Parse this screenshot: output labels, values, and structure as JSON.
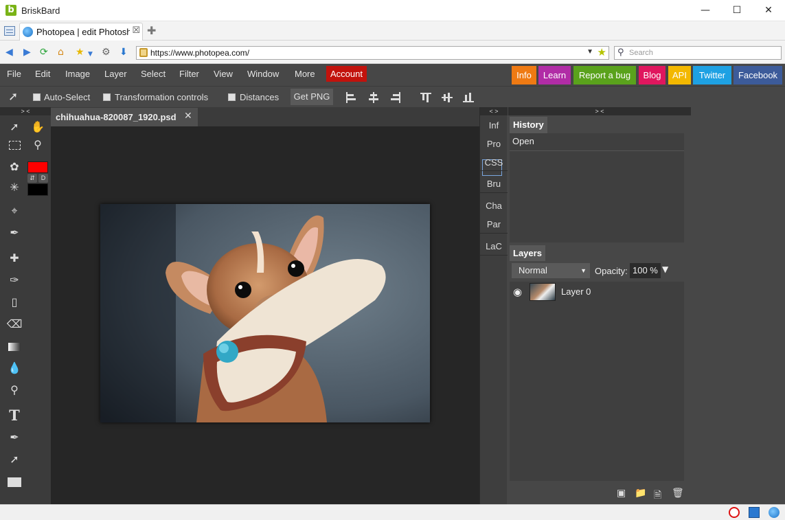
{
  "browser": {
    "title": "BriskBard",
    "logo_letter": "b",
    "tab_label": "Photopea | edit Photoshop",
    "url": "https://www.photopea.com/",
    "search_placeholder": "Search"
  },
  "menu": {
    "items": [
      "File",
      "Edit",
      "Image",
      "Layer",
      "Select",
      "Filter",
      "View",
      "Window",
      "More"
    ],
    "account": "Account",
    "links": [
      {
        "label": "Info",
        "color": "#ef7a13"
      },
      {
        "label": "Learn",
        "color": "#b12ca6"
      },
      {
        "label": "Report a bug",
        "color": "#5aa21c"
      },
      {
        "label": "Blog",
        "color": "#e0165e"
      },
      {
        "label": "API",
        "color": "#f3b800"
      },
      {
        "label": "Twitter",
        "color": "#1ea1e3"
      },
      {
        "label": "Facebook",
        "color": "#3c5b9a"
      }
    ]
  },
  "options": {
    "auto_select": "Auto-Select",
    "transform_controls": "Transformation controls",
    "distances": "Distances",
    "get_png": "Get PNG"
  },
  "document": {
    "tab_name": "chihuahua-820087_1920.psd"
  },
  "side_strip": [
    "Inf",
    "Pro",
    "CSS",
    "Bru",
    "Cha",
    "Par",
    "LaC"
  ],
  "history": {
    "title": "History",
    "items": [
      "Open"
    ]
  },
  "layers": {
    "title": "Layers",
    "blend_mode": "Normal",
    "opacity_label": "Opacity:",
    "opacity_value": "100 %",
    "items": [
      {
        "name": "Layer 0"
      }
    ]
  },
  "colors": {
    "foreground": "#ff0000",
    "background": "#000000",
    "swap_label": "⇵",
    "default_label": "D"
  },
  "collapse_labels": {
    "left": "> <",
    "middle": "< >",
    "right": "> <"
  }
}
